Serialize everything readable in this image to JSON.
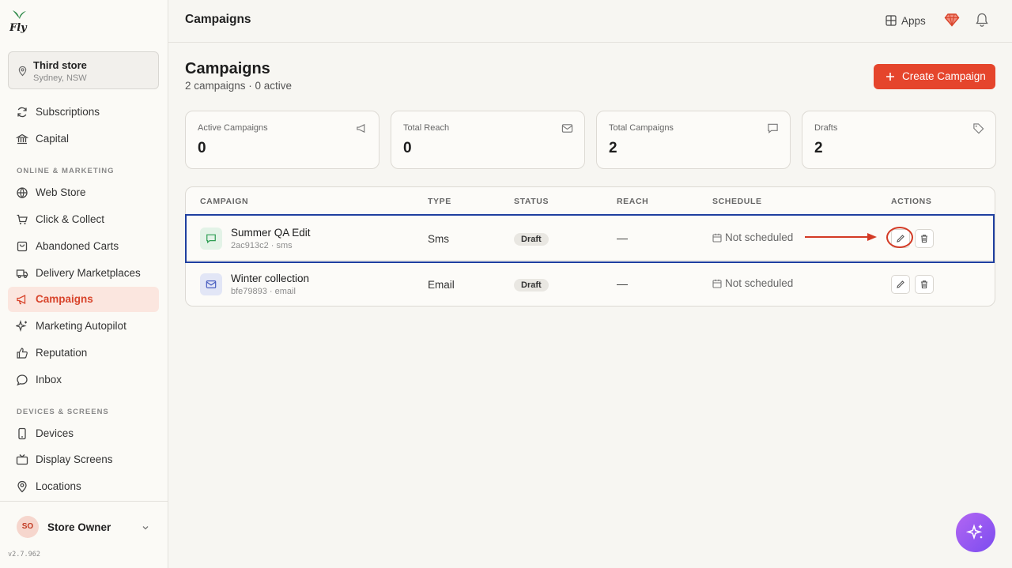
{
  "app": {
    "logo_text": "Fly",
    "version": "v2.7.962"
  },
  "store": {
    "name": "Third store",
    "location": "Sydney, NSW"
  },
  "sidebar": {
    "items_top": [
      {
        "label": "Subscriptions",
        "icon": "refresh-icon"
      },
      {
        "label": "Capital",
        "icon": "bank-icon"
      }
    ],
    "section_online": "ONLINE & MARKETING",
    "items_online": [
      {
        "label": "Web Store",
        "icon": "globe-icon"
      },
      {
        "label": "Click & Collect",
        "icon": "cart-icon"
      },
      {
        "label": "Abandoned Carts",
        "icon": "shopping-bag-icon"
      },
      {
        "label": "Delivery Marketplaces",
        "icon": "truck-icon"
      },
      {
        "label": "Campaigns",
        "icon": "megaphone-icon",
        "active": true
      },
      {
        "label": "Marketing Autopilot",
        "icon": "sparkle-icon"
      },
      {
        "label": "Reputation",
        "icon": "thumbs-up-icon"
      },
      {
        "label": "Inbox",
        "icon": "chat-icon"
      }
    ],
    "section_devices": "DEVICES & SCREENS",
    "items_devices": [
      {
        "label": "Devices",
        "icon": "phone-icon"
      },
      {
        "label": "Display Screens",
        "icon": "tv-icon"
      },
      {
        "label": "Locations",
        "icon": "map-pin-icon"
      }
    ]
  },
  "user": {
    "initials": "SO",
    "name": "Store Owner"
  },
  "topbar": {
    "title": "Campaigns",
    "apps_label": "Apps"
  },
  "page": {
    "title": "Campaigns",
    "subtitle": "2 campaigns · 0 active",
    "create_label": "Create Campaign"
  },
  "stats": [
    {
      "label": "Active Campaigns",
      "value": "0",
      "icon": "megaphone-icon"
    },
    {
      "label": "Total Reach",
      "value": "0",
      "icon": "mail-icon"
    },
    {
      "label": "Total Campaigns",
      "value": "2",
      "icon": "message-icon"
    },
    {
      "label": "Drafts",
      "value": "2",
      "icon": "tag-icon"
    }
  ],
  "table": {
    "headers": [
      "CAMPAIGN",
      "TYPE",
      "STATUS",
      "REACH",
      "SCHEDULE",
      "ACTIONS"
    ],
    "rows": [
      {
        "name": "Summer QA Edit",
        "meta": "2ac913c2 · sms",
        "type": "Sms",
        "status": "Draft",
        "reach": "—",
        "schedule": "Not scheduled",
        "icon": "message-icon",
        "icon_color": "#2f9e54",
        "icon_bg": "#e3f3e7"
      },
      {
        "name": "Winter collection",
        "meta": "bfe79893 · email",
        "type": "Email",
        "status": "Draft",
        "reach": "—",
        "schedule": "Not scheduled",
        "icon": "mail-icon",
        "icon_color": "#4a5fc1",
        "icon_bg": "#e2e6f6"
      }
    ]
  },
  "colors": {
    "accent": "#e5452c",
    "active_bg": "#fbe6df",
    "highlight": "#1f3fa0",
    "annotation": "#d33a25"
  }
}
